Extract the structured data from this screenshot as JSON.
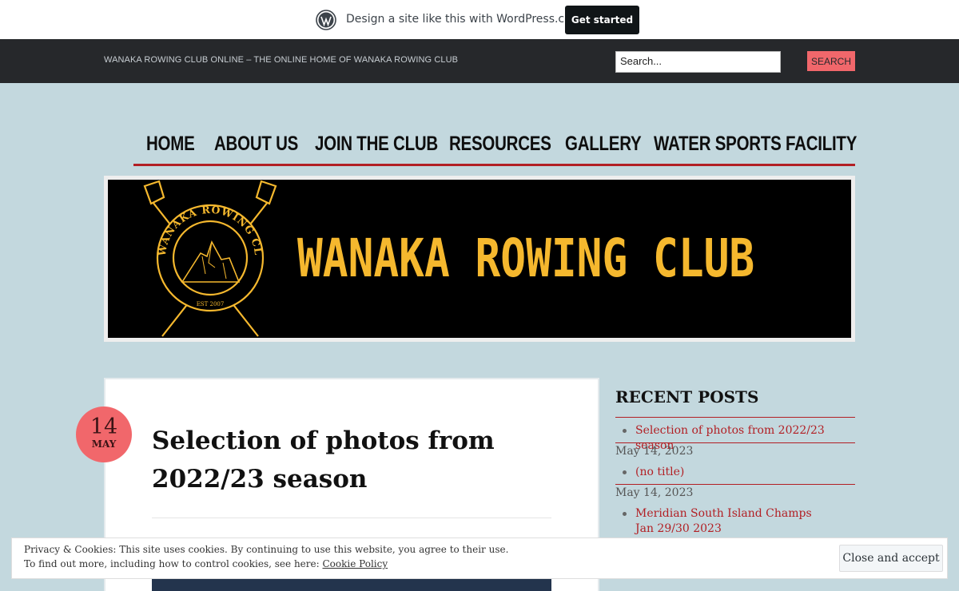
{
  "promo": {
    "text": "Design a site like this with WordPress.com",
    "cta": "Get started"
  },
  "header": {
    "tagline": "WANAKA ROWING CLUB ONLINE – THE ONLINE HOME OF WANAKA ROWING CLUB",
    "search_placeholder": "Search...",
    "search_button": "SEARCH"
  },
  "nav": {
    "items": [
      "HOME",
      "ABOUT US",
      "JOIN THE CLUB",
      "RESOURCES",
      "GALLERY",
      "WATER SPORTS FACILITY"
    ]
  },
  "banner": {
    "title": "WANAKA ROWING CLUB",
    "logo_ring_text": "WANAKA ROWING CLUB",
    "logo_est": "EST 2007"
  },
  "post": {
    "day": "14",
    "month": "MAY",
    "title": "Selection of photos from 2022/23 season"
  },
  "sidebar": {
    "title": "RECENT POSTS",
    "posts": [
      {
        "label": "Selection of photos from 2022/23 season",
        "date": "May 14, 2023"
      },
      {
        "label": "(no title)",
        "date": "May 14, 2023"
      },
      {
        "label": "Meridian South Island Champs Jan 29/30 2023",
        "date": ""
      }
    ]
  },
  "cookie": {
    "line1": "Privacy & Cookies: This site uses cookies. By continuing to use this website, you agree to their use.",
    "line2_prefix": "To find out more, including how to control cookies, see here: ",
    "policy_link": "Cookie Policy",
    "close_button": "Close and accept"
  },
  "colors": {
    "accent": "#f1676b",
    "nav_rule": "#b21f24",
    "banner_text": "#f5b82e",
    "page_bg": "#c3d8de",
    "topbar_bg": "#26282b"
  }
}
